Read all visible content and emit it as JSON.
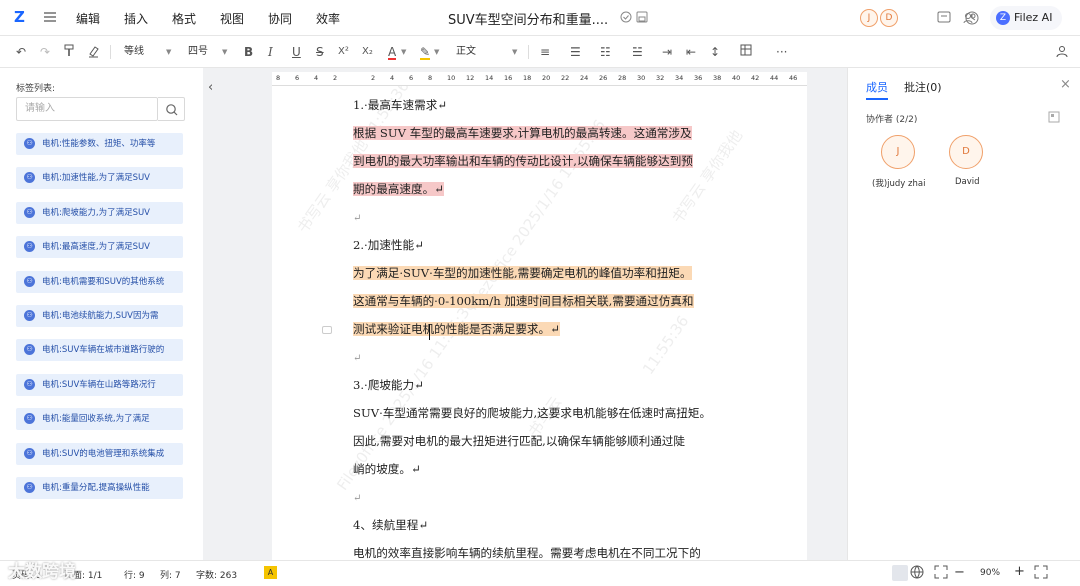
{
  "topbar": {
    "logo": "Z",
    "menu": [
      "编辑",
      "插入",
      "格式",
      "视图",
      "协同",
      "效率"
    ],
    "doc_title": "SUV车型空间分布和重量....",
    "avatars": [
      "J",
      "D"
    ],
    "filez_label": "Filez AI"
  },
  "toolbar": {
    "font_name": "等线",
    "font_size": "四号",
    "style": "正文",
    "buttons": [
      "B",
      "I",
      "U",
      "S",
      "X²",
      "X₂"
    ],
    "more": "···"
  },
  "left_panel": {
    "title": "标签列表:",
    "search_placeholder": "请输入",
    "tags": [
      "电机:性能参数、扭矩、功率等",
      "电机:加速性能,为了满足SUV",
      "电机:爬坡能力,为了满足SUV",
      "电机:最高速度,为了满足SUV",
      "电机:电机需要和SUV的其他系统",
      "电机:电池续航能力,SUV因为需",
      "电机:SUV车辆在城市道路行驶的",
      "电机:SUV车辆在山路等路况行",
      "电机:能量回收系统,为了满足",
      "电机:SUV的电池管理和系统集成",
      "电机:重量分配,提高操纵性能"
    ]
  },
  "ruler": {
    "ticks": [
      "8",
      "6",
      "4",
      "2",
      "",
      "2",
      "4",
      "6",
      "8",
      "10",
      "12",
      "14",
      "16",
      "18",
      "20",
      "22",
      "24",
      "26",
      "28",
      "30",
      "32",
      "34",
      "36",
      "38",
      "40",
      "42",
      "44",
      "46"
    ]
  },
  "document": {
    "paragraphs": [
      {
        "text": "1.·最高车速需求↵",
        "style": "plain"
      },
      {
        "text": "根据 SUV 车型的最高车速要求,计算电机的最高转速。这通常涉及",
        "style": "red"
      },
      {
        "text": "到电机的最大功率输出和车辆的传动比设计,以确保车辆能够达到预",
        "style": "red"
      },
      {
        "text": "期的最高速度。↵",
        "style": "red"
      },
      {
        "text": "↵",
        "style": "return"
      },
      {
        "text": "2.·加速性能↵",
        "style": "plain"
      },
      {
        "text": "为了满足·SUV·车型的加速性能,需要确定电机的峰值功率和扭矩。",
        "style": "orange"
      },
      {
        "text": "这通常与车辆的·0-100km/h 加速时间目标相关联,需要通过仿真和",
        "style": "orange"
      },
      {
        "text": "测试来验证电机的性能是否满足要求。↵",
        "style": "orange"
      },
      {
        "text": "↵",
        "style": "return"
      },
      {
        "text": "3.·爬坡能力↵",
        "style": "plain"
      },
      {
        "text": "SUV·车型通常需要良好的爬坡能力,这要求电机能够在低速时高扭矩。",
        "style": "plain"
      },
      {
        "text": "因此,需要对电机的最大扭矩进行匹配,以确保车辆能够顺利通过陡",
        "style": "plain"
      },
      {
        "text": "峭的坡度。↵",
        "style": "plain"
      },
      {
        "text": "↵",
        "style": "return"
      },
      {
        "text": "4、续航里程↵",
        "style": "plain"
      },
      {
        "text": "电机的效率直接影响车辆的续航里程。需要考虑电机在不同工况下的",
        "style": "plain"
      }
    ],
    "watermarks": [
      "书写云 享你我他 11:55:36",
      "Filez0ffice 2025/1/16 11:55:36",
      "书写云 享你我他",
      "Filez0ffice 2025/1/16 11:55:36",
      "书写云",
      "11:55:36"
    ]
  },
  "right_panel": {
    "tabs": [
      "成员",
      "批注(0)"
    ],
    "collab_title": "协作者 (2/2)",
    "members": [
      {
        "initial": "J",
        "name": "(我)judy zhai"
      },
      {
        "initial": "D",
        "name": "David"
      }
    ]
  },
  "statusbar": {
    "page_label": "页码: 1",
    "pages_label": "页面: 1/1",
    "line_label": "行: 9",
    "col_label": "列: 7",
    "words_label": "字数: 263",
    "badge": "A",
    "zoom": "90%",
    "watermark_brand": "大数跨境"
  },
  "colors": {
    "accent": "#1a66ff",
    "tag_bg": "#e8f0fc",
    "highlight_red": "#f6c8c8",
    "highlight_orange": "#fbd9b5"
  }
}
